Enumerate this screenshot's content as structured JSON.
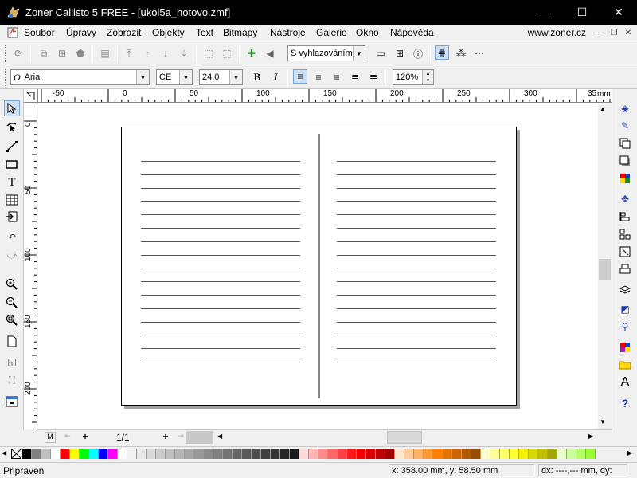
{
  "window": {
    "title": "Zoner Callisto 5 FREE - [ukol5a_hotovo.zmf]",
    "controls": {
      "minimize": "—",
      "maximize": "☐",
      "close": "✕"
    }
  },
  "menu": {
    "items": [
      "Soubor",
      "Úpravy",
      "Zobrazit",
      "Objekty",
      "Text",
      "Bitmapy",
      "Nástroje",
      "Galerie",
      "Okno",
      "Nápověda"
    ],
    "link": "www.zoner.cz",
    "mdi": {
      "minimize": "—",
      "restore": "❐",
      "close": "✕"
    }
  },
  "toolbar": {
    "smoothing_select": "S vyhlazováním",
    "font_name": "Arial",
    "font_prefix": "O",
    "charset": "CE",
    "font_size": "24.0",
    "bold": "B",
    "italic": "I",
    "zoom": "120%"
  },
  "ruler": {
    "unit": "mm",
    "top_labels": [
      "-50",
      "0",
      "50",
      "100",
      "150",
      "200",
      "250",
      "300",
      "35"
    ],
    "left_labels": [
      "0",
      "50",
      "100",
      "150",
      "200"
    ]
  },
  "pagebar": {
    "page_indicator": "1/1",
    "first": "M",
    "add_before": "+",
    "add_after": "+"
  },
  "status": {
    "text": "Připraven",
    "coords": "x: 358.00 mm, y: 58.50 mm",
    "delta": "dx: ----,--- mm, dy:"
  },
  "document": {
    "lines_per_column": 16
  },
  "colors": {
    "palette": [
      "#000000",
      "#808080",
      "#c0c0c0",
      "#ffffff",
      "#ff0000",
      "#ffff00",
      "#00ff00",
      "#00ffff",
      "#0000ff",
      "#ff00ff",
      "#ffffff",
      "#f2f2f2",
      "#e6e6e6",
      "#d9d9d9",
      "#cccccc",
      "#bfbfbf",
      "#b3b3b3",
      "#a6a6a6",
      "#999999",
      "#8c8c8c",
      "#808080",
      "#737373",
      "#666666",
      "#595959",
      "#4d4d4d",
      "#404040",
      "#333333",
      "#262626",
      "#1a1a1a",
      "#ffd9d9",
      "#ffb3b3",
      "#ff8c8c",
      "#ff6666",
      "#ff4040",
      "#ff1a1a",
      "#f20000",
      "#d90000",
      "#bf0000",
      "#a60000",
      "#ffe6cc",
      "#ffcc99",
      "#ffb366",
      "#ff9933",
      "#ff8000",
      "#e67300",
      "#cc6600",
      "#b35900",
      "#994d00",
      "#ffffcc",
      "#ffff99",
      "#ffff66",
      "#ffff33",
      "#f2f200",
      "#d9d900",
      "#bfbf00",
      "#a6a600",
      "#e6ffcc",
      "#ccff99",
      "#b3ff66",
      "#99ff33"
    ]
  }
}
